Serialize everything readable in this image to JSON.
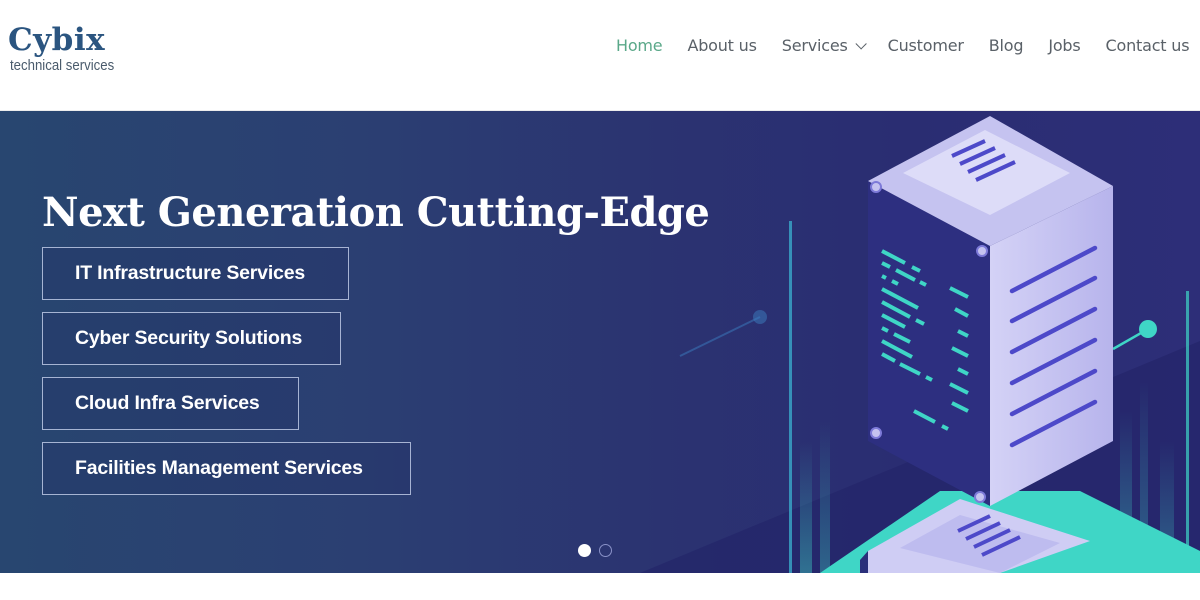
{
  "brand": {
    "name": "Cybix",
    "tagline": "technical services"
  },
  "nav": {
    "items": [
      {
        "label": "Home",
        "active": true
      },
      {
        "label": "About us",
        "active": false
      },
      {
        "label": "Services",
        "active": false,
        "has_dropdown": true
      },
      {
        "label": "Customer",
        "active": false
      },
      {
        "label": "Blog",
        "active": false
      },
      {
        "label": "Jobs",
        "active": false
      },
      {
        "label": "Contact us",
        "active": false
      }
    ]
  },
  "hero": {
    "title": "Next Generation Cutting-Edge",
    "services": [
      "IT Infrastructure Services",
      "Cyber Security Solutions",
      "Cloud Infra Services",
      "Facilities Management Services"
    ],
    "carousel": {
      "total_slides": 2,
      "active_slide": 1
    },
    "illustration": "isometric-server-rack"
  },
  "colors": {
    "brand_blue": "#2b5580",
    "nav_active": "#5aa889",
    "nav_text": "#5a6168",
    "hero_bg": "#2b3371",
    "accent_teal": "#3fd6c6",
    "server_face": "#c9c8f2"
  }
}
